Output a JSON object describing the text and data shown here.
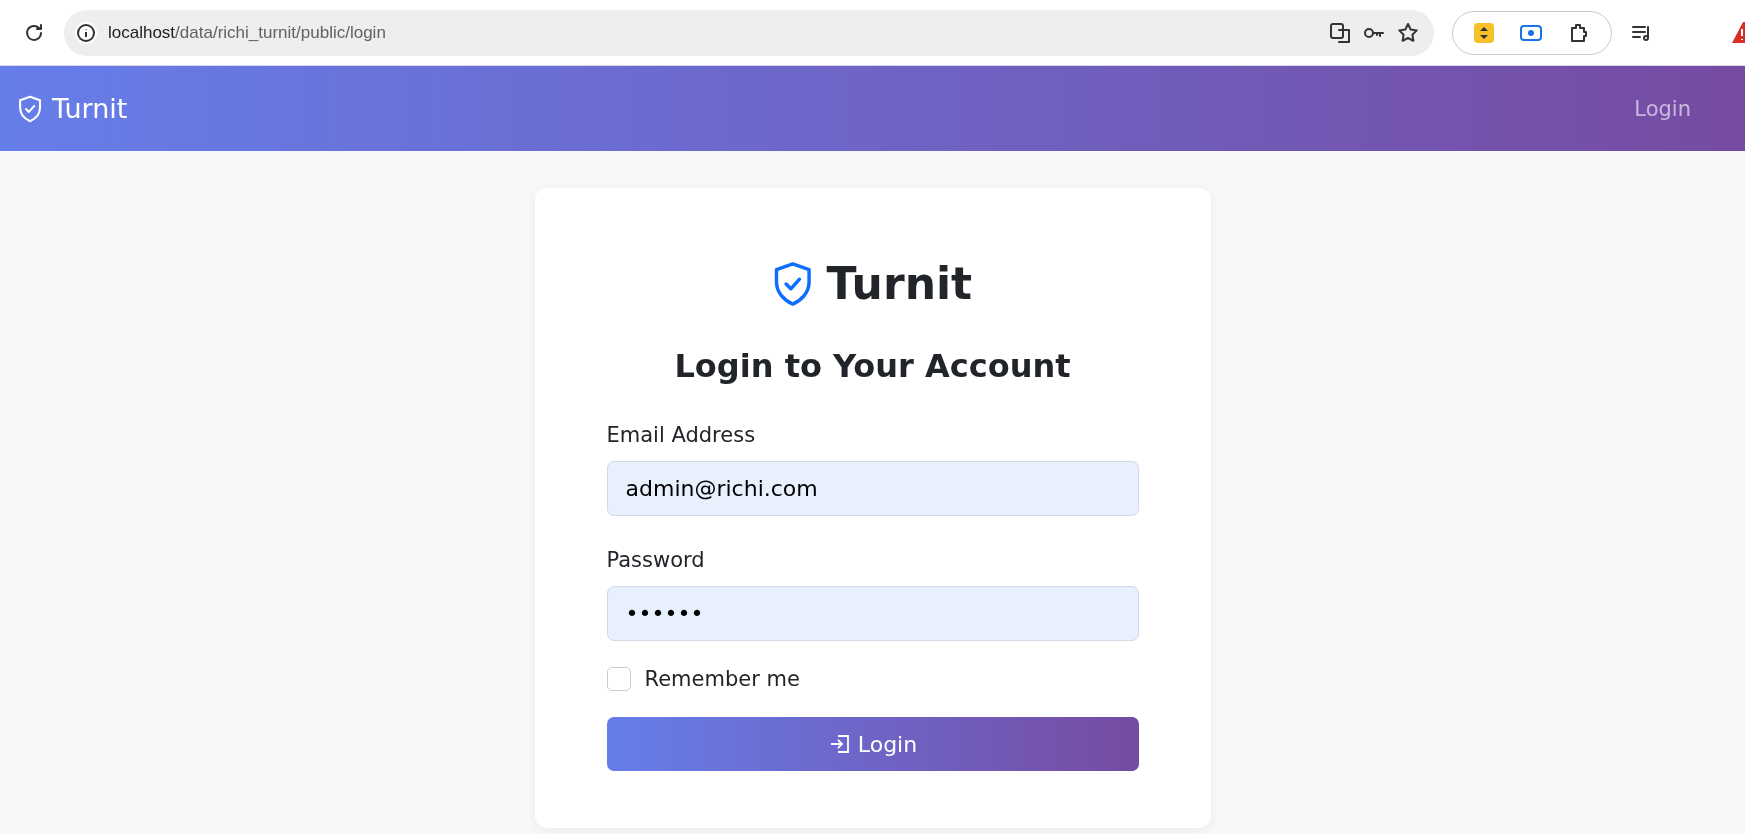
{
  "browser": {
    "url_host": "localhost",
    "url_path": "/data/richi_turnit/public/login"
  },
  "navbar": {
    "brand": "Turnit",
    "links": [
      {
        "label": "Login",
        "selected": false
      }
    ]
  },
  "card": {
    "logo_text": "Turnit",
    "heading": "Login to Your Account",
    "fields": [
      {
        "label": "Email Address",
        "value": "admin@richi.com"
      },
      {
        "label": "Password",
        "value": "••••••"
      }
    ],
    "remember": {
      "label": "Remember me",
      "checked": false
    },
    "submit": "Login"
  }
}
